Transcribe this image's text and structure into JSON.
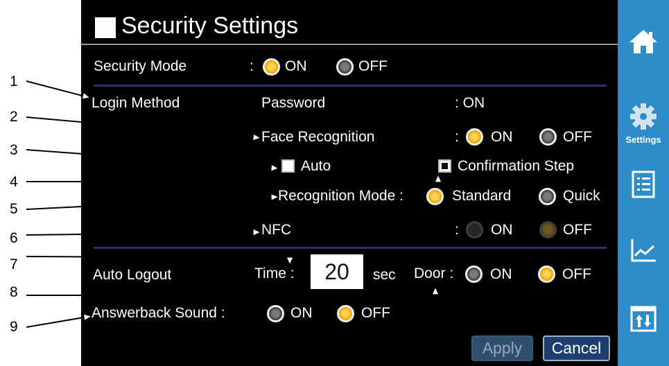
{
  "window": {
    "title": "Security Settings"
  },
  "security_mode": {
    "label": "Security Mode",
    "sep": ":",
    "on": "ON",
    "off": "OFF",
    "selected": "ON"
  },
  "login_method": {
    "label": "Login Method",
    "password_label": "Password",
    "password_value": ": ON",
    "face_label": "Face Recognition",
    "face_sep": ":",
    "face_on": "ON",
    "face_off": "OFF",
    "face_selected": "ON",
    "auto_label": "Auto",
    "auto_checked": false,
    "confirm_label": "Confirmation Step",
    "confirm_checked": true,
    "mode_label": "Recognition Mode :",
    "mode_standard": "Standard",
    "mode_quick": "Quick",
    "mode_selected": "Standard",
    "nfc_label": "NFC",
    "nfc_sep": ":",
    "nfc_on": "ON",
    "nfc_off": "OFF",
    "nfc_disabled": true
  },
  "auto_logout": {
    "label": "Auto Logout",
    "time_label": "Time :",
    "time_value": "20",
    "time_unit": "sec",
    "door_label": "Door :",
    "door_on": "ON",
    "door_off": "OFF",
    "door_selected": "OFF"
  },
  "answerback": {
    "label": "Answerback Sound :",
    "on": "ON",
    "off": "OFF",
    "selected": "OFF"
  },
  "buttons": {
    "apply": "Apply",
    "cancel": "Cancel",
    "apply_enabled": false
  },
  "sidebar": {
    "items": [
      {
        "icon": "home-icon"
      },
      {
        "icon": "gear-icon",
        "label": "Settings",
        "active": true
      },
      {
        "icon": "checklist-icon"
      },
      {
        "icon": "line-chart-icon"
      },
      {
        "icon": "transfer-icon"
      }
    ]
  },
  "callouts": [
    "1",
    "2",
    "3",
    "4",
    "5",
    "6",
    "7",
    "8",
    "9"
  ],
  "colors": {
    "sidebar": "#2e8dc8",
    "accent_on": "#f4a400",
    "separator": "#26336b",
    "screen_bg": "#000000"
  }
}
